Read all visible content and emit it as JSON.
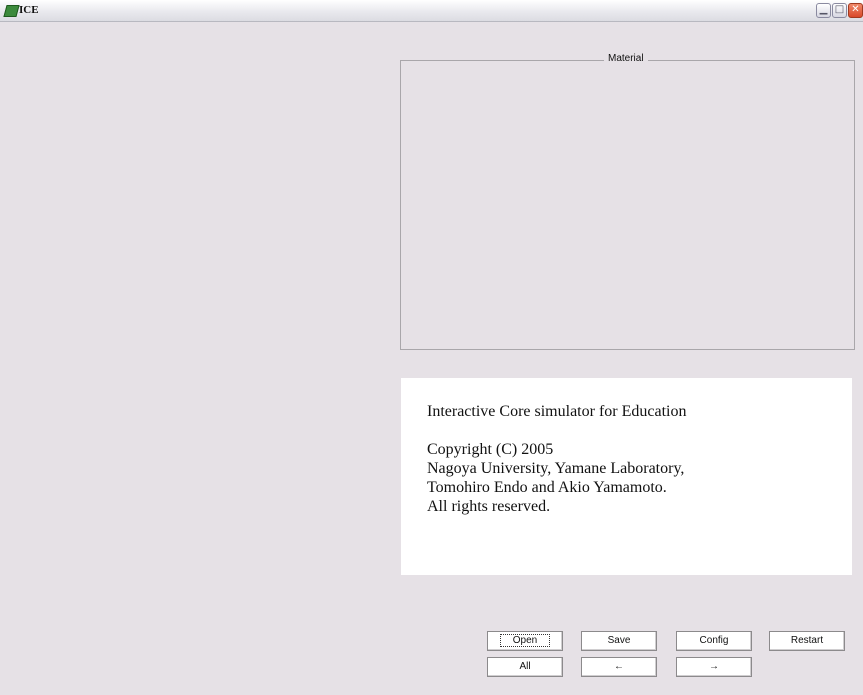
{
  "window": {
    "title": "ICE",
    "minimize_glyph": "▁",
    "maximize_glyph": "□",
    "close_glyph": "✕"
  },
  "material": {
    "label": "Material"
  },
  "info": {
    "heading": "Interactive Core simulator for Education",
    "lines": [
      "Copyright (C) 2005",
      "Nagoya University, Yamane Laboratory,",
      "Tomohiro Endo and Akio Yamamoto.",
      "All rights reserved."
    ]
  },
  "buttons": {
    "open": "Open",
    "save": "Save",
    "config": "Config",
    "restart": "Restart",
    "all": "All",
    "back": "←",
    "forward": "→"
  }
}
